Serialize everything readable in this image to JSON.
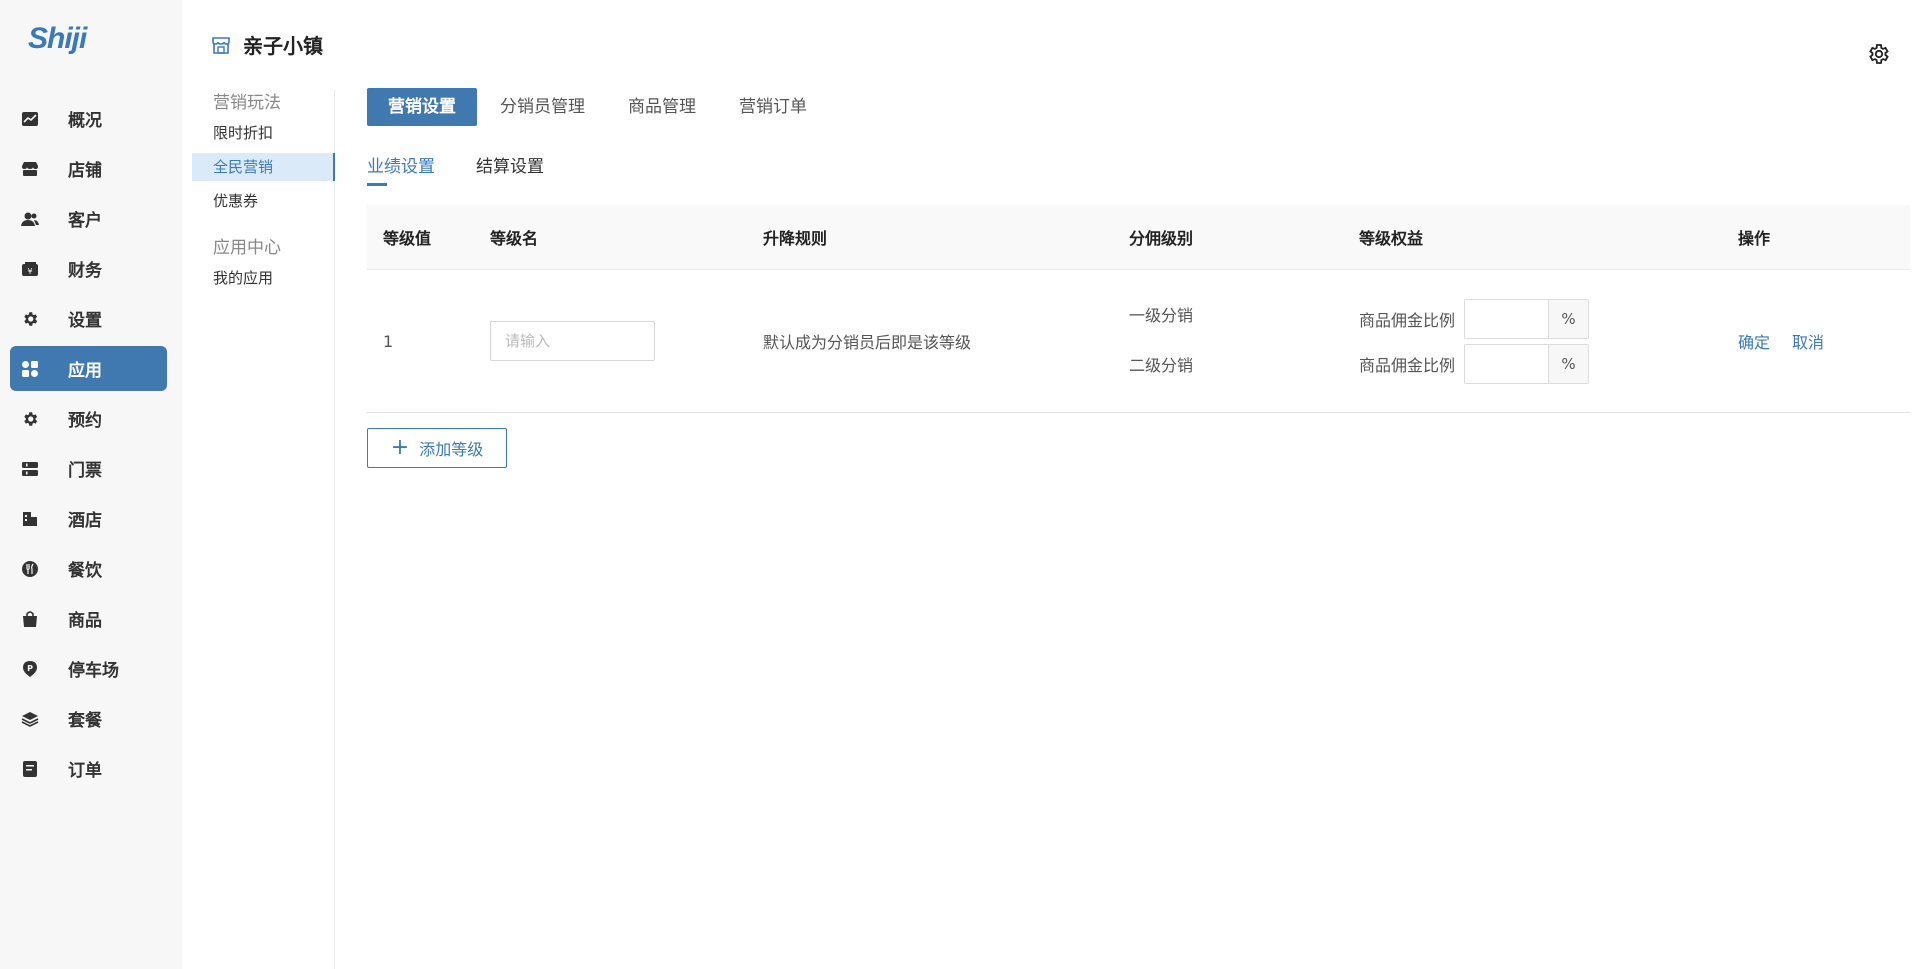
{
  "brand": {
    "name": "Shiji",
    "accent": "#4078b0"
  },
  "nav": {
    "items": [
      {
        "label": "概况",
        "icon": "chart-icon"
      },
      {
        "label": "店铺",
        "icon": "store-icon"
      },
      {
        "label": "客户",
        "icon": "users-icon"
      },
      {
        "label": "财务",
        "icon": "wallet-icon"
      },
      {
        "label": "设置",
        "icon": "gear-icon"
      },
      {
        "label": "应用",
        "icon": "apps-icon",
        "active": true
      },
      {
        "label": "预约",
        "icon": "gear-icon"
      },
      {
        "label": "门票",
        "icon": "ticket-icon"
      },
      {
        "label": "酒店",
        "icon": "hotel-icon"
      },
      {
        "label": "餐饮",
        "icon": "dining-icon"
      },
      {
        "label": "商品",
        "icon": "bag-icon"
      },
      {
        "label": "停车场",
        "icon": "parking-icon"
      },
      {
        "label": "套餐",
        "icon": "layers-icon"
      },
      {
        "label": "订单",
        "icon": "order-icon"
      }
    ]
  },
  "header": {
    "title": "亲子小镇"
  },
  "subnav": {
    "group1": "营销玩法",
    "items1": [
      "限时折扣",
      "全民营销",
      "优惠券"
    ],
    "group2": "应用中心",
    "items2": [
      "我的应用"
    ]
  },
  "tabs": [
    "营销设置",
    "分销员管理",
    "商品管理",
    "营销订单"
  ],
  "subtabs": [
    "业绩设置",
    "结算设置"
  ],
  "table": {
    "headers": [
      "等级值",
      "等级名",
      "升降规则",
      "分佣级别",
      "等级权益",
      "操作"
    ],
    "row": {
      "level": "1",
      "name_placeholder": "请输入",
      "rule": "默认成为分销员后即是该等级",
      "levels": [
        "一级分销",
        "二级分销"
      ],
      "benefit_label": "商品佣金比例",
      "unit": "%",
      "confirm": "确定",
      "cancel": "取消"
    }
  },
  "add_button": "添加等级"
}
